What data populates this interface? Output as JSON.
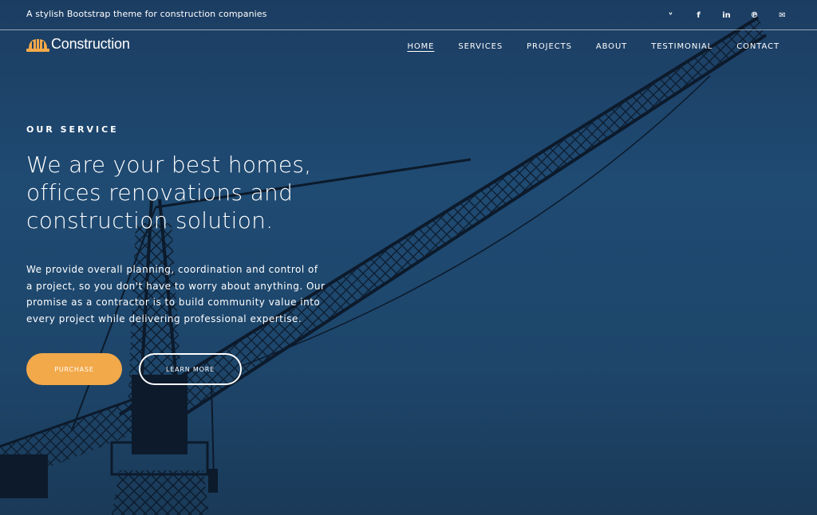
{
  "topbar": {
    "tagline": "A stylish Bootstrap theme for construction companies",
    "social": [
      {
        "icon": "twitter-icon",
        "glyph": "ᵛ"
      },
      {
        "icon": "facebook-icon",
        "glyph": "f"
      },
      {
        "icon": "linkedin-icon",
        "glyph": "in"
      },
      {
        "icon": "pinterest-icon",
        "glyph": "℗"
      },
      {
        "icon": "mail-icon",
        "glyph": "✉"
      }
    ]
  },
  "brand": {
    "name": "Construction",
    "accent_color": "#f2a94a",
    "logo_icon": "hard-hat-icon"
  },
  "nav": {
    "items": [
      {
        "label": "HOME",
        "active": true
      },
      {
        "label": "SERVICES",
        "active": false
      },
      {
        "label": "PROJECTS",
        "active": false
      },
      {
        "label": "ABOUT",
        "active": false
      },
      {
        "label": "TESTIMONIAL",
        "active": false
      },
      {
        "label": "CONTACT",
        "active": false
      }
    ]
  },
  "hero": {
    "eyebrow": "OUR SERVICE",
    "headline_lines": [
      "We are your best homes,",
      "offices renovations and",
      "construction solution."
    ],
    "description_lines": [
      "We provide overall planning, coordination and control of",
      "a project, so you don't have to worry about anything. Our",
      "promise as a contractor is to build community value into",
      "every project while delivering professional expertise."
    ],
    "primary_button": "PURCHASE",
    "secondary_button": "LEARN MORE"
  }
}
